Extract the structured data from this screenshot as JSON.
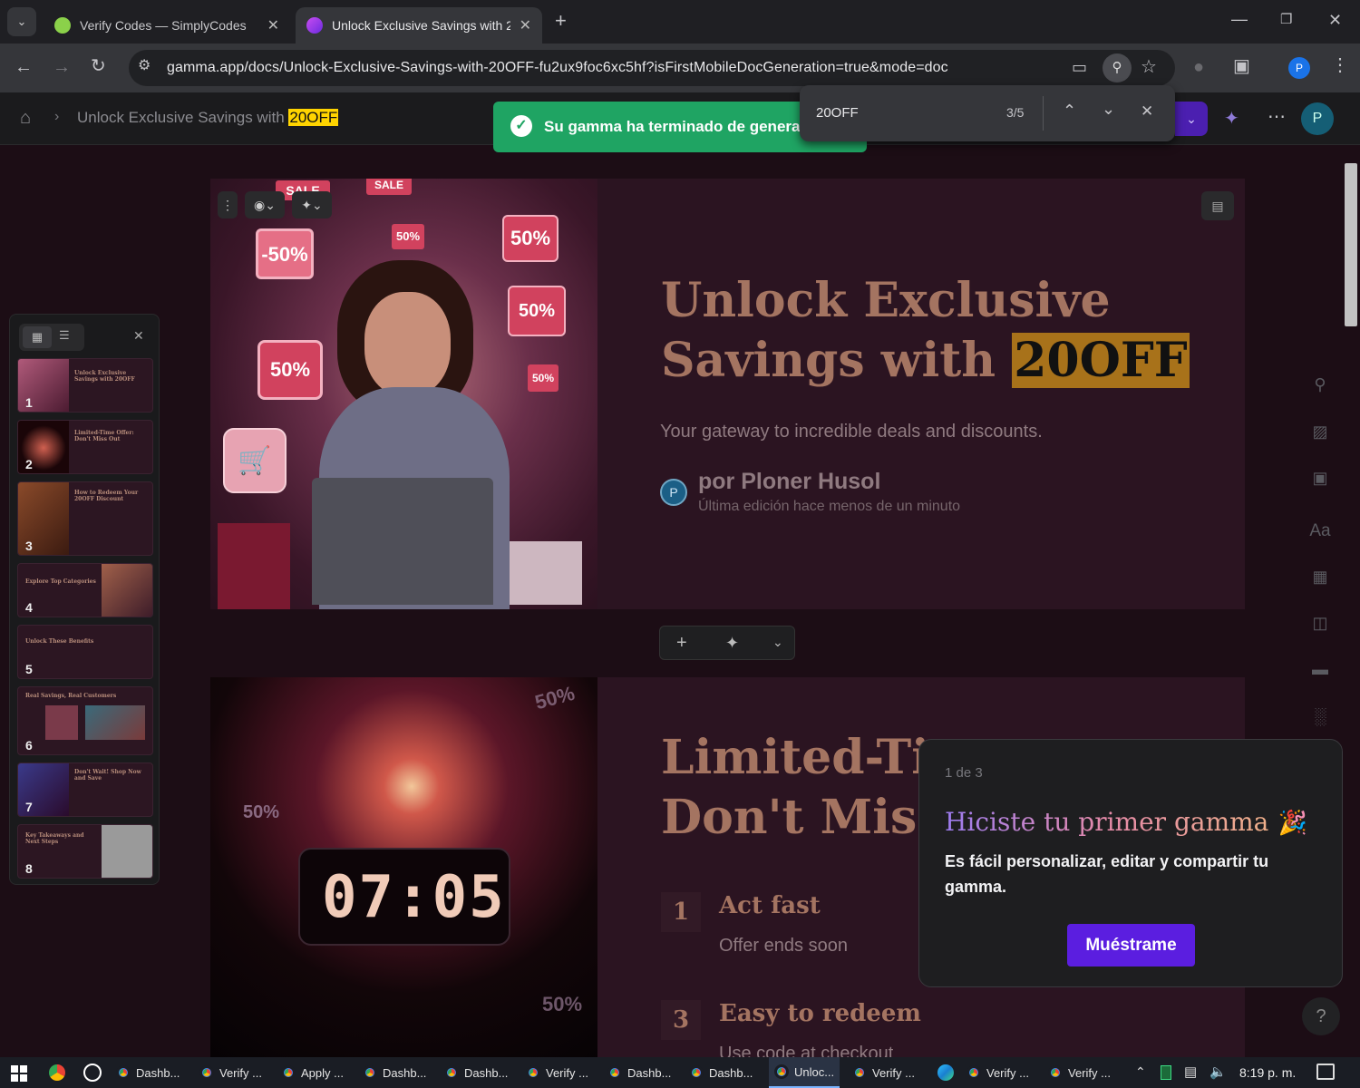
{
  "browser": {
    "tabs": [
      {
        "title": "Verify Codes — SimplyCodes",
        "active": false
      },
      {
        "title": "Unlock Exclusive Savings with 2",
        "active": true
      }
    ],
    "url": "gamma.app/docs/Unlock-Exclusive-Savings-with-20OFF-fu2ux9foc6xc5hf?isFirstMobileDocGeneration=true&mode=doc",
    "profile_initial": "P"
  },
  "app_header": {
    "breadcrumb_prefix": "Unlock Exclusive Savings with ",
    "breadcrumb_highlight": "20OFF",
    "avatar_initial": "P"
  },
  "toast": {
    "text": "Su gamma ha terminado de generar"
  },
  "find_bar": {
    "query": "20OFF",
    "count": "3/5"
  },
  "card1": {
    "title_line1": "Unlock Exclusive",
    "title_line2_prefix": "Savings with ",
    "title_line2_highlight": "20OFF",
    "subtitle": "Your gateway to incredible deals and discounts.",
    "author_initial": "P",
    "author": "por Ploner Husol",
    "edited": "Última edición hace menos de un minuto",
    "image_tags": [
      "SALE",
      "SALE",
      "-50%",
      "50%",
      "50%",
      "50%",
      "50%",
      "50%"
    ]
  },
  "card2": {
    "title_line1": "Limited-Ti",
    "title_line2": "Don't Miss",
    "items": [
      {
        "num": "1",
        "title": "Act fast",
        "desc": "Offer ends soon"
      },
      {
        "num": "3",
        "title": "Easy to redeem",
        "desc": "Use code at checkout"
      }
    ],
    "clock": "07:05",
    "image_tags": [
      "50%",
      "50%",
      "50%"
    ]
  },
  "thumbnails": [
    {
      "num": "1",
      "title": "Unlock Exclusive Savings with 20OFF"
    },
    {
      "num": "2",
      "title": "Limited-Time Offer: Don't Miss Out"
    },
    {
      "num": "3",
      "title": "How to Redeem Your 20OFF Discount"
    },
    {
      "num": "4",
      "title": "Explore Top Categories"
    },
    {
      "num": "5",
      "title": "Unlock These Benefits"
    },
    {
      "num": "6",
      "title": "Real Savings, Real Customers"
    },
    {
      "num": "7",
      "title": "Don't Wait! Shop Now and Save"
    },
    {
      "num": "8",
      "title": "Key Takeaways and Next Steps"
    }
  ],
  "popover": {
    "step": "1 de 3",
    "title": "Hiciste tu primer gamma",
    "body": "Es fácil personalizar, editar y compartir tu gamma.",
    "button": "Muéstrame"
  },
  "taskbar": {
    "items": [
      "Dashb...",
      "Verify ...",
      "Apply ...",
      "Dashb...",
      "Dashb...",
      "Verify ...",
      "Dashb...",
      "Dashb...",
      "Unloc...",
      "Verify ...",
      "Verify ...",
      "Verify ..."
    ],
    "time": "8:19 p. m."
  },
  "colors": {
    "accent_purple": "#5b1ee0",
    "toast_green": "#1fa463",
    "highlight": "#ffd400",
    "card_bg": "#2b1421",
    "title_color": "#a47461"
  }
}
